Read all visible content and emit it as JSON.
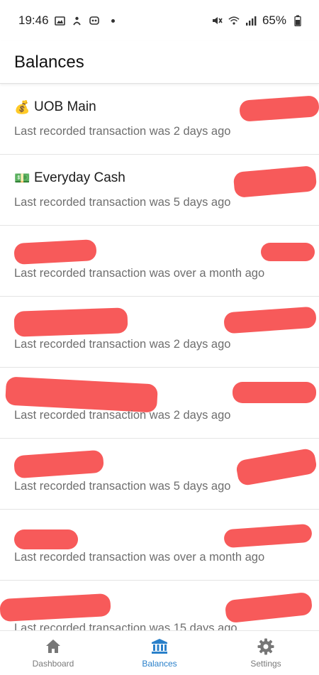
{
  "status_bar": {
    "time": "19:46",
    "battery": "65%"
  },
  "app_bar": {
    "title": "Balances"
  },
  "accounts": [
    {
      "name": "UOB Main",
      "emoji": "💰",
      "subtitle": "Last recorded transaction was 2 days ago"
    },
    {
      "name": "Everyday Cash",
      "emoji": "💵",
      "subtitle": "Last recorded transaction was 5 days ago"
    },
    {
      "name": "",
      "emoji": "",
      "subtitle": "Last recorded transaction was over a month ago"
    },
    {
      "name": "",
      "emoji": "",
      "subtitle": "Last recorded transaction was 2 days ago"
    },
    {
      "name": "",
      "emoji": "",
      "subtitle": "Last recorded transaction was 2 days ago"
    },
    {
      "name": "",
      "emoji": "",
      "subtitle": "Last recorded transaction was 5 days ago"
    },
    {
      "name": "",
      "emoji": "",
      "subtitle": "Last recorded transaction was over a month ago"
    },
    {
      "name": "",
      "emoji": "",
      "subtitle": "Last recorded transaction was 15 days ago"
    }
  ],
  "bottom_nav": {
    "items": [
      {
        "label": "Dashboard",
        "icon": "home-icon",
        "active": false
      },
      {
        "label": "Balances",
        "icon": "bank-icon",
        "active": true
      },
      {
        "label": "Settings",
        "icon": "gear-icon",
        "active": false
      }
    ]
  },
  "colors": {
    "accent": "#2a80ca",
    "redaction": "#f75a5a",
    "subtitle": "#6e6e6e"
  }
}
